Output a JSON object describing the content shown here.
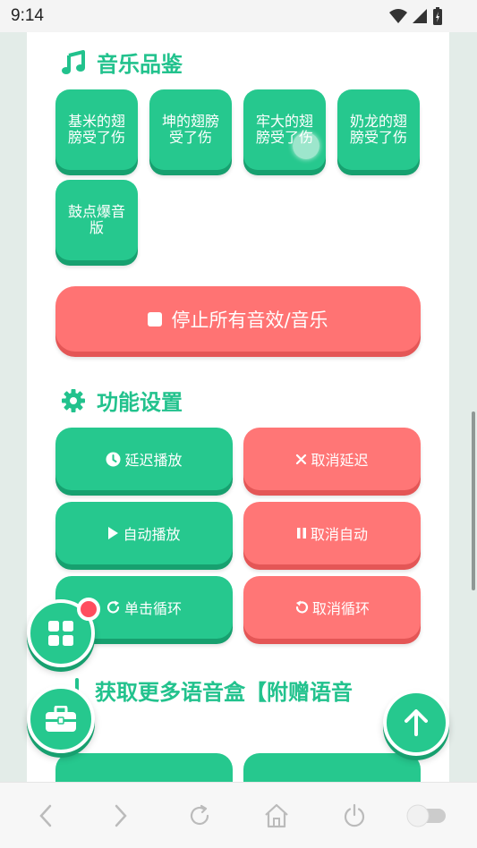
{
  "status_bar": {
    "time": "9:14"
  },
  "music_section": {
    "title": "音乐品鉴",
    "tiles": [
      {
        "label": "基米的翅膀受了伤"
      },
      {
        "label": "坤的翅膀受了伤"
      },
      {
        "label": "牢大的翅膀受了伤"
      },
      {
        "label": "奶龙的翅膀受了伤"
      },
      {
        "label": "鼓点爆音版"
      }
    ],
    "stop_label": "停止所有音效/音乐"
  },
  "settings_section": {
    "title": "功能设置",
    "buttons": [
      {
        "label": "延迟播放",
        "icon": "clock-icon"
      },
      {
        "label": "取消延迟",
        "icon": "x-icon"
      },
      {
        "label": "自动播放",
        "icon": "play-icon"
      },
      {
        "label": "取消自动",
        "icon": "pause-icon"
      },
      {
        "label": "单击循环",
        "icon": "redo-icon"
      },
      {
        "label": "取消循环",
        "icon": "undo-icon"
      }
    ]
  },
  "more_section": {
    "title": "获取更多语音盒【附赠语音"
  },
  "colors": {
    "accent_green": "#26c88e",
    "accent_red": "#ff7373",
    "badge_red": "#ff4d5e"
  }
}
